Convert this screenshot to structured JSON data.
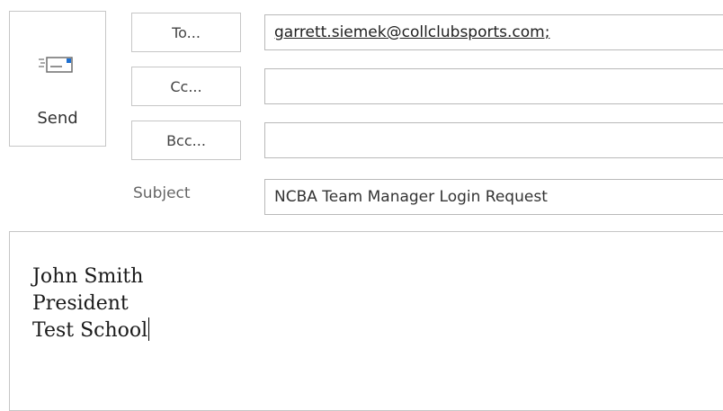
{
  "send": {
    "label": "Send",
    "icon": "send-envelope-icon"
  },
  "buttons": {
    "to": "To...",
    "cc": "Cc...",
    "bcc": "Bcc..."
  },
  "fields": {
    "to_value": "garrett.siemek@collclubsports.com;",
    "cc_value": "",
    "bcc_value": "",
    "subject_label": "Subject",
    "subject_value": "NCBA Team Manager Login Request"
  },
  "message_body": {
    "lines": [
      "John Smith",
      "President",
      "Test School"
    ]
  },
  "colors": {
    "border": "#c6c6c6",
    "envelope_accent": "#1e6fd0"
  }
}
